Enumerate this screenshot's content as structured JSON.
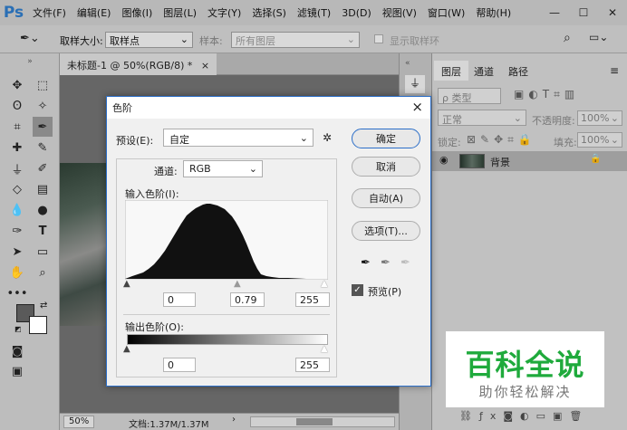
{
  "app": {
    "logo": "Ps"
  },
  "menubar": {
    "items": [
      "文件(F)",
      "编辑(E)",
      "图像(I)",
      "图层(L)",
      "文字(Y)",
      "选择(S)",
      "滤镜(T)",
      "3D(D)",
      "视图(V)",
      "窗口(W)",
      "帮助(H)"
    ]
  },
  "options": {
    "sample_size_label": "取样大小:",
    "sample_size_value": "取样点",
    "sample_label": "样本:",
    "sample_value": "所有图层",
    "show_ring_label": "显示取样环"
  },
  "document": {
    "tab_title": "未标题-1 @ 50%(RGB/8) *",
    "close": "×",
    "zoom": "50%",
    "doc_info": "文档:1.37M/1.37M"
  },
  "layers_panel": {
    "tabs": [
      "图层",
      "通道",
      "路径"
    ],
    "filter_label": "ρ 类型",
    "blend_mode": "正常",
    "opacity_label": "不透明度:",
    "opacity_value": "100%",
    "lock_label": "锁定:",
    "fill_label": "填充:",
    "fill_value": "100%",
    "layer_name": "背景"
  },
  "dialog": {
    "title": "色阶",
    "close": "×",
    "preset_label": "预设(E):",
    "preset_value": "自定",
    "channel_label": "通道:",
    "channel_value": "RGB",
    "input_levels_label": "输入色阶(I):",
    "input_black": "0",
    "input_gamma": "0.79",
    "input_white": "255",
    "output_levels_label": "输出色阶(O):",
    "output_black": "0",
    "output_white": "255",
    "buttons": {
      "ok": "确定",
      "cancel": "取消",
      "auto": "自动(A)",
      "options": "选项(T)..."
    },
    "preview_label": "预览(P)",
    "preview_checked": true
  },
  "watermark": {
    "title": "百科全说",
    "subtitle": "助你轻松解决",
    "title_color": "#1faa3c"
  },
  "colors": {
    "accent": "#2b6ec8",
    "foreground": "#5a5a5a",
    "background": "#ffffff"
  }
}
